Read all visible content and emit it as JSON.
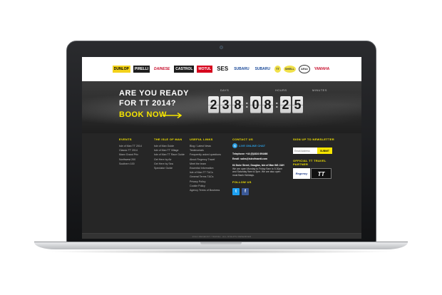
{
  "sponsors": [
    "DUNLOP",
    "PIRELLI",
    "DAINESE",
    "CASTROL",
    "MOTUL",
    "SES",
    "SUBARU",
    "SUBARU",
    "TT",
    "SHELL",
    "ARAI",
    "YAMAHA"
  ],
  "hero": {
    "line1": "ARE YOU READY",
    "line2": "FOR TT 2014?",
    "book": "BOOK NOW",
    "countdown": {
      "labels": [
        "DAYS",
        "HOURS",
        "MINUTES"
      ],
      "digits": [
        "2",
        "3",
        "8",
        "0",
        "8",
        "2",
        "5"
      ]
    }
  },
  "footer": {
    "events": {
      "heading": "EVENTS",
      "items": [
        "Isle of Man TT 2014",
        "Classic TT 2014",
        "Manx Grand Prix",
        "Northwest 200",
        "Southern 100"
      ]
    },
    "isle": {
      "heading": "THE ISLE OF MAN",
      "items": [
        "Isle of Man Guide",
        "Isle of Man TT Village",
        "Isle of Man TT Race Guide",
        "Get Here by Air",
        "Get Here by Sea",
        "Spectator Guide"
      ]
    },
    "links": {
      "heading": "USEFUL LINKS",
      "items": [
        "Blog / Latest News",
        "Testimonials",
        "Frequently asked questions",
        "About Regency Travel",
        "Meet the team",
        "Essential Information",
        "Isle of Man TT T&Cs",
        "General Terms T&Cs",
        "Privacy Policy",
        "Cookie Policy",
        "Agency Terms of Business"
      ]
    },
    "contact": {
      "heading": "CONTACT US",
      "chat": "LIVE ONLINE CHAT",
      "telephone": "Telephone: +44 (0)1624 694466",
      "email": "Email: sales@isleofmantt.com",
      "address": "64 Duke Street, Douglas, Isle of Man IM1 2AH",
      "hours1": "We are open Monday to Friday 9am to 5.30pm and Saturday 9am to 3pm. We are also open most Bank",
      "hours2": "Holidays.",
      "follow": "FOLLOW US",
      "twitter": "t",
      "facebook": "f"
    },
    "newsletter": {
      "heading": "SIGN UP TO NEWSLETTER",
      "placeholder": "Email Address",
      "submit": "SUBMIT",
      "partner_line1": "OFFICIAL TT TRAVEL",
      "partner_line2": "PARTNER",
      "regency": "Regency",
      "tt_logo": "TT"
    },
    "bottom": "2014 REGENCY TRAVEL. ALL RIGHTS RESERVED"
  },
  "colors": {
    "accent_yellow": "#f6e500",
    "chat_blue": "#2a9de0",
    "twitter_blue": "#1da1f2",
    "facebook_blue": "#3b5998"
  }
}
